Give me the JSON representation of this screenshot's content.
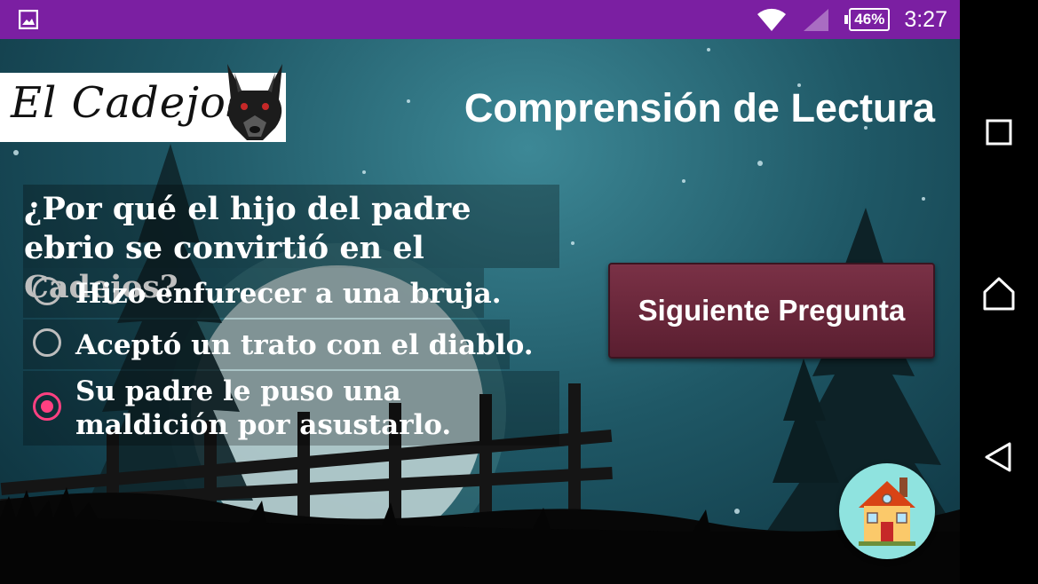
{
  "status_bar": {
    "time": "3:27",
    "battery_percent": "46%",
    "icons": [
      "gallery-icon",
      "wifi-icon",
      "signal-icon",
      "battery-icon"
    ]
  },
  "nav_bar": {
    "buttons": [
      "recents-icon",
      "home-icon",
      "back-icon"
    ]
  },
  "app": {
    "logo_text": "El Cadejos",
    "title": "Comprensión de Lectura",
    "question": "¿Por qué el hijo del padre ebrio se convirtió en el Cadejos?",
    "options": [
      {
        "label": "Hizo enfurecer a una bruja.",
        "selected": false
      },
      {
        "label": "Aceptó un trato con el diablo.",
        "selected": false
      },
      {
        "label": "Su padre le puso una maldición por asustarlo.",
        "selected": true
      }
    ],
    "next_button_label": "Siguiente Pregunta",
    "home_button_icon": "house-icon"
  },
  "colors": {
    "status_bar": "#7b1fa2",
    "accent": "#ff4081",
    "button": "#6a2539",
    "home_circle": "#8fe3df"
  }
}
